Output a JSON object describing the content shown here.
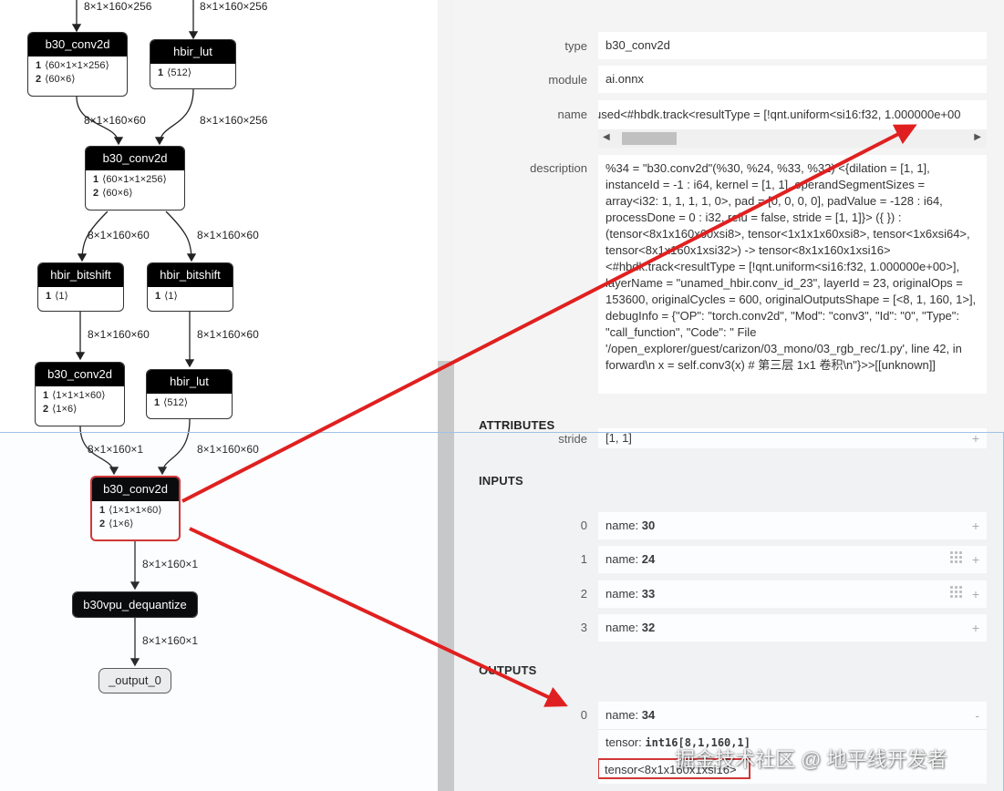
{
  "graph": {
    "nodes": [
      {
        "id": "n1",
        "title": "b30_conv2d",
        "attrs": [
          [
            "1",
            "⟨60×1×1×256⟩"
          ],
          [
            "2",
            "⟨60×6⟩"
          ]
        ]
      },
      {
        "id": "n2",
        "title": "hbir_lut",
        "attrs": [
          [
            "1",
            "⟨512⟩"
          ]
        ]
      },
      {
        "id": "n3",
        "title": "b30_conv2d",
        "attrs": [
          [
            "1",
            "⟨60×1×1×256⟩"
          ],
          [
            "2",
            "⟨60×6⟩"
          ]
        ]
      },
      {
        "id": "n4",
        "title": "hbir_bitshift",
        "attrs": [
          [
            "1",
            "⟨1⟩"
          ]
        ]
      },
      {
        "id": "n5",
        "title": "hbir_bitshift",
        "attrs": [
          [
            "1",
            "⟨1⟩"
          ]
        ]
      },
      {
        "id": "n6",
        "title": "b30_conv2d",
        "attrs": [
          [
            "1",
            "⟨1×1×1×60⟩"
          ],
          [
            "2",
            "⟨1×6⟩"
          ]
        ]
      },
      {
        "id": "n7",
        "title": "hbir_lut",
        "attrs": [
          [
            "1",
            "⟨512⟩"
          ]
        ]
      },
      {
        "id": "n8",
        "title": "b30_conv2d",
        "attrs": [
          [
            "1",
            "⟨1×1×1×60⟩"
          ],
          [
            "2",
            "⟨1×6⟩"
          ]
        ]
      },
      {
        "id": "n9",
        "title": "b30vpu_dequantize",
        "attrs": []
      },
      {
        "id": "n10",
        "title": "_output_0",
        "attrs": []
      }
    ],
    "edge_labels": [
      "8×1×160×256",
      "8×1×160×256",
      "8×1×160×60",
      "8×1×160×256",
      "8×1×160×60",
      "8×1×160×60",
      "8×1×160×60",
      "8×1×160×60",
      "8×1×160×1",
      "8×1×160×60",
      "8×1×160×1",
      "8×1×160×1"
    ]
  },
  "properties": {
    "type_label": "type",
    "type_value": "b30_conv2d",
    "module_label": "module",
    "module_value": "ai.onnx",
    "name_label": "name",
    "name_value": "used<#hbdk.track<resultType = [!qnt.uniform<si16:f32, 1.000000e+00",
    "description_label": "description",
    "description_value": "%34 = \"b30.conv2d\"(%30, %24, %33, %32) <{dilation = [1, 1], instanceId = -1 : i64, kernel = [1, 1], operandSegmentSizes = array<i32: 1, 1, 1, 1, 0>, pad = [0, 0, 0, 0], padValue = -128 : i64, processDone = 0 : i32, relu = false, stride = [1, 1]}> ({ }) : (tensor<8x1x160x60xsi8>, tensor<1x1x1x60xsi8>, tensor<1x6xsi64>, tensor<8x1x160x1xsi32>) -> tensor<8x1x160x1xsi16> <#hbdk.track<resultType = [!qnt.uniform<si16:f32, 1.000000e+00>], layerName = \"unamed_hbir.conv_id_23\", layerId = 23, originalOps = 153600, originalCycles = 600, originalOutputsShape = [<8, 1, 160, 1>], debugInfo = {\"OP\": \"torch.conv2d\", \"Mod\": \"conv3\", \"Id\": \"0\", \"Type\": \"call_function\", \"Code\": \" File '/open_explorer/guest/carizon/03_mono/03_rgb_rec/1.py', line 42, in forward\\n x = self.conv3(x) # 第三层 1x1 卷积\\n\"}>>[[unknown]]",
    "attributes_title": "ATTRIBUTES",
    "stride_label": "stride",
    "stride_value": "[1, 1]",
    "inputs_title": "INPUTS",
    "inputs": [
      {
        "index": "0",
        "name_prefix": "name: ",
        "name": "30"
      },
      {
        "index": "1",
        "name_prefix": "name: ",
        "name": "24"
      },
      {
        "index": "2",
        "name_prefix": "name: ",
        "name": "33"
      },
      {
        "index": "3",
        "name_prefix": "name: ",
        "name": "32"
      }
    ],
    "outputs_title": "OUTPUTS",
    "output": {
      "index": "0",
      "name_prefix": "name: ",
      "name": "34",
      "tensor_prefix": "tensor: ",
      "tensor_value": "int16[8,1,160,1]",
      "tensor_raw": "tensor<8x1x160x1xsi16>"
    },
    "plus_glyph": "+",
    "minus_glyph": "-"
  },
  "watermark": "掘金技术社区 @ 地平线开发者",
  "colors": {
    "highlight": "#e02020",
    "node_header": "#000000",
    "panel_bg": "#f4f4f4"
  }
}
